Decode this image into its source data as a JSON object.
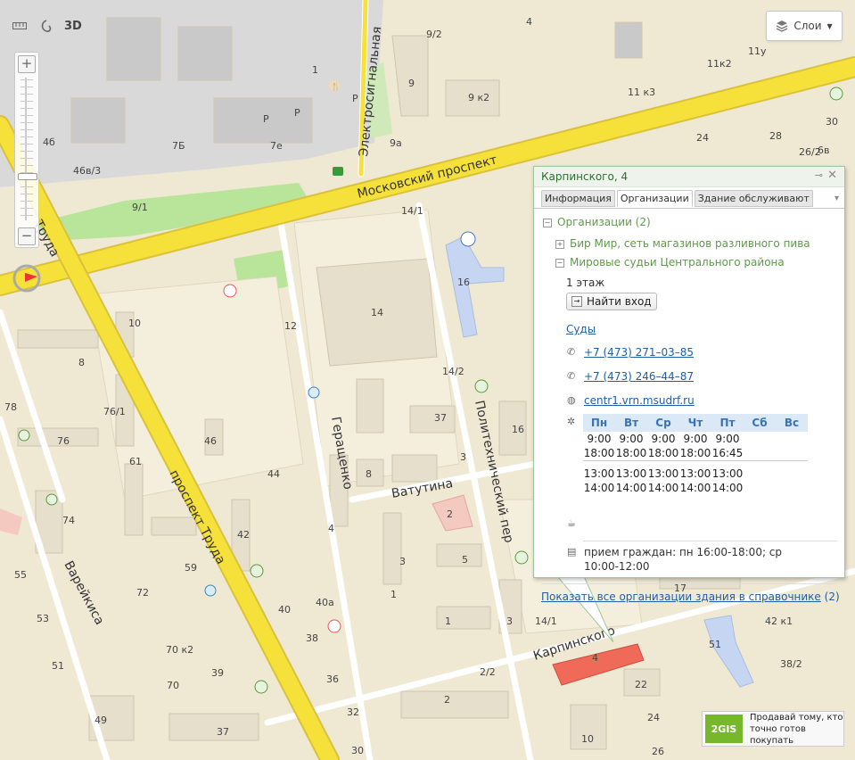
{
  "toolbar": {
    "ruler_icon": "ruler-icon",
    "locate_icon": "route-icon",
    "label_3d": "3D"
  },
  "layers_button": {
    "label": "Слои",
    "icon": "layers-icon"
  },
  "streets": {
    "moskovsky": "Московский проспект",
    "elektrosignalnaya": "Электросигнальная",
    "truda": "проспект Труда",
    "truda_short": "Труда",
    "gerashchenko": "Геращенко",
    "vatutina": "Ватутина",
    "politekhnichesky": "Политехнический пер",
    "karpinskogo": "Карпинского",
    "vareikisa": "Варейкиса"
  },
  "building_labels": [
    "4",
    "9/2",
    "11к2",
    "11у",
    "1",
    "9",
    "9 к2",
    "11 к3",
    "30",
    "7Б",
    "7е",
    "9а",
    "24",
    "28",
    "4б",
    "46в/3",
    "9/1",
    "26/2",
    "14/1",
    "16",
    "10",
    "14",
    "12",
    "8",
    "78",
    "76/1",
    "76",
    "61",
    "46",
    "14/2",
    "37",
    "16",
    "44",
    "8",
    "3",
    "74",
    "2",
    "3",
    "5",
    "42",
    "72",
    "59",
    "4",
    "55",
    "53",
    "40",
    "40а",
    "1",
    "1",
    "3",
    "14/1",
    "42 к1",
    "51",
    "51",
    "38",
    "70 к2",
    "39",
    "36",
    "70",
    "22",
    "2/2",
    "2",
    "38/2",
    "49",
    "37",
    "32",
    "24",
    "30",
    "10",
    "26",
    "6в",
    "17",
    "4",
    "Р",
    "Р",
    "Р"
  ],
  "popup": {
    "title": "Карпинского, 4",
    "tabs": [
      "Информация",
      "Организации",
      "Здание обслуживают"
    ],
    "active_tab": "Организации",
    "org_header": "Организации (2)",
    "org1": "Бир Мир, сеть магазинов разливного пива",
    "org2": "Мировые судьи Центрального района",
    "floor": "1 этаж",
    "find_entrance": "Найти вход",
    "category": "Суды",
    "phone1": "+7 (473) 271–03–85",
    "phone2": "+7 (473) 246–44–87",
    "website": "centr1.vrn.msudrf.ru",
    "schedule": {
      "days": [
        "Пн",
        "Вт",
        "Ср",
        "Чт",
        "Пт",
        "Сб",
        "Вс"
      ],
      "work_start": [
        "9:00",
        "9:00",
        "9:00",
        "9:00",
        "9:00"
      ],
      "work_end": [
        "18:00",
        "18:00",
        "18:00",
        "18:00",
        "16:45"
      ],
      "break_start": [
        "13:00",
        "13:00",
        "13:00",
        "13:00",
        "13:00"
      ],
      "break_end": [
        "14:00",
        "14:00",
        "14:00",
        "14:00",
        "14:00"
      ]
    },
    "note": "прием граждан: пн 16:00-18:00; ср 10:00-12:00",
    "note_line1": "прием граждан: пн 16:00-18:00; ср",
    "note_line2": "10:00-12:00",
    "show_all": "Показать все организации здания в справочнике",
    "show_all_count": "(2)"
  },
  "ad": {
    "logo": "2GIS",
    "line1": "Продавай тому, кто",
    "line2": "точно готов покупать"
  },
  "colors": {
    "road_major": "#f5e13a",
    "road_minor": "#ffffff",
    "park": "#b9e59a",
    "building": "#e6dfcc",
    "industrial": "#d9d9d9",
    "highlight": "#f06a5a",
    "school": "#c6d6f2"
  }
}
